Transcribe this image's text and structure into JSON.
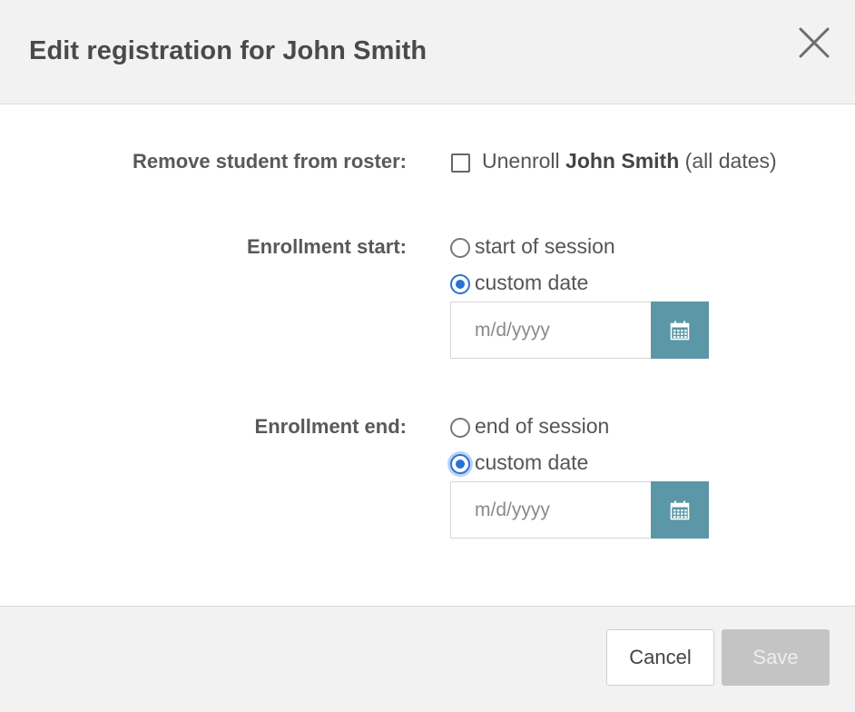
{
  "dialog": {
    "title": "Edit registration for John Smith",
    "close_icon": "close-icon"
  },
  "remove": {
    "label": "Remove student from roster:",
    "checkbox_checked": false,
    "option_prefix": "Unenroll ",
    "student_name": "John Smith",
    "option_suffix": " (all dates)"
  },
  "start": {
    "label": "Enrollment start:",
    "options": [
      {
        "label": "start of session",
        "checked": false
      },
      {
        "label": "custom date",
        "checked": true
      }
    ],
    "date_placeholder": "m/d/yyyy",
    "calendar_icon": "calendar-icon"
  },
  "end": {
    "label": "Enrollment end:",
    "options": [
      {
        "label": "end of session",
        "checked": false
      },
      {
        "label": "custom date",
        "checked": true
      }
    ],
    "date_placeholder": "m/d/yyyy",
    "calendar_icon": "calendar-icon"
  },
  "footer": {
    "cancel_label": "Cancel",
    "save_label": "Save"
  },
  "colors": {
    "accent_blue": "#2b72d8",
    "calendar_button": "#5b97a6",
    "disabled_button": "#c4c4c4",
    "header_bg": "#f2f2f2"
  }
}
